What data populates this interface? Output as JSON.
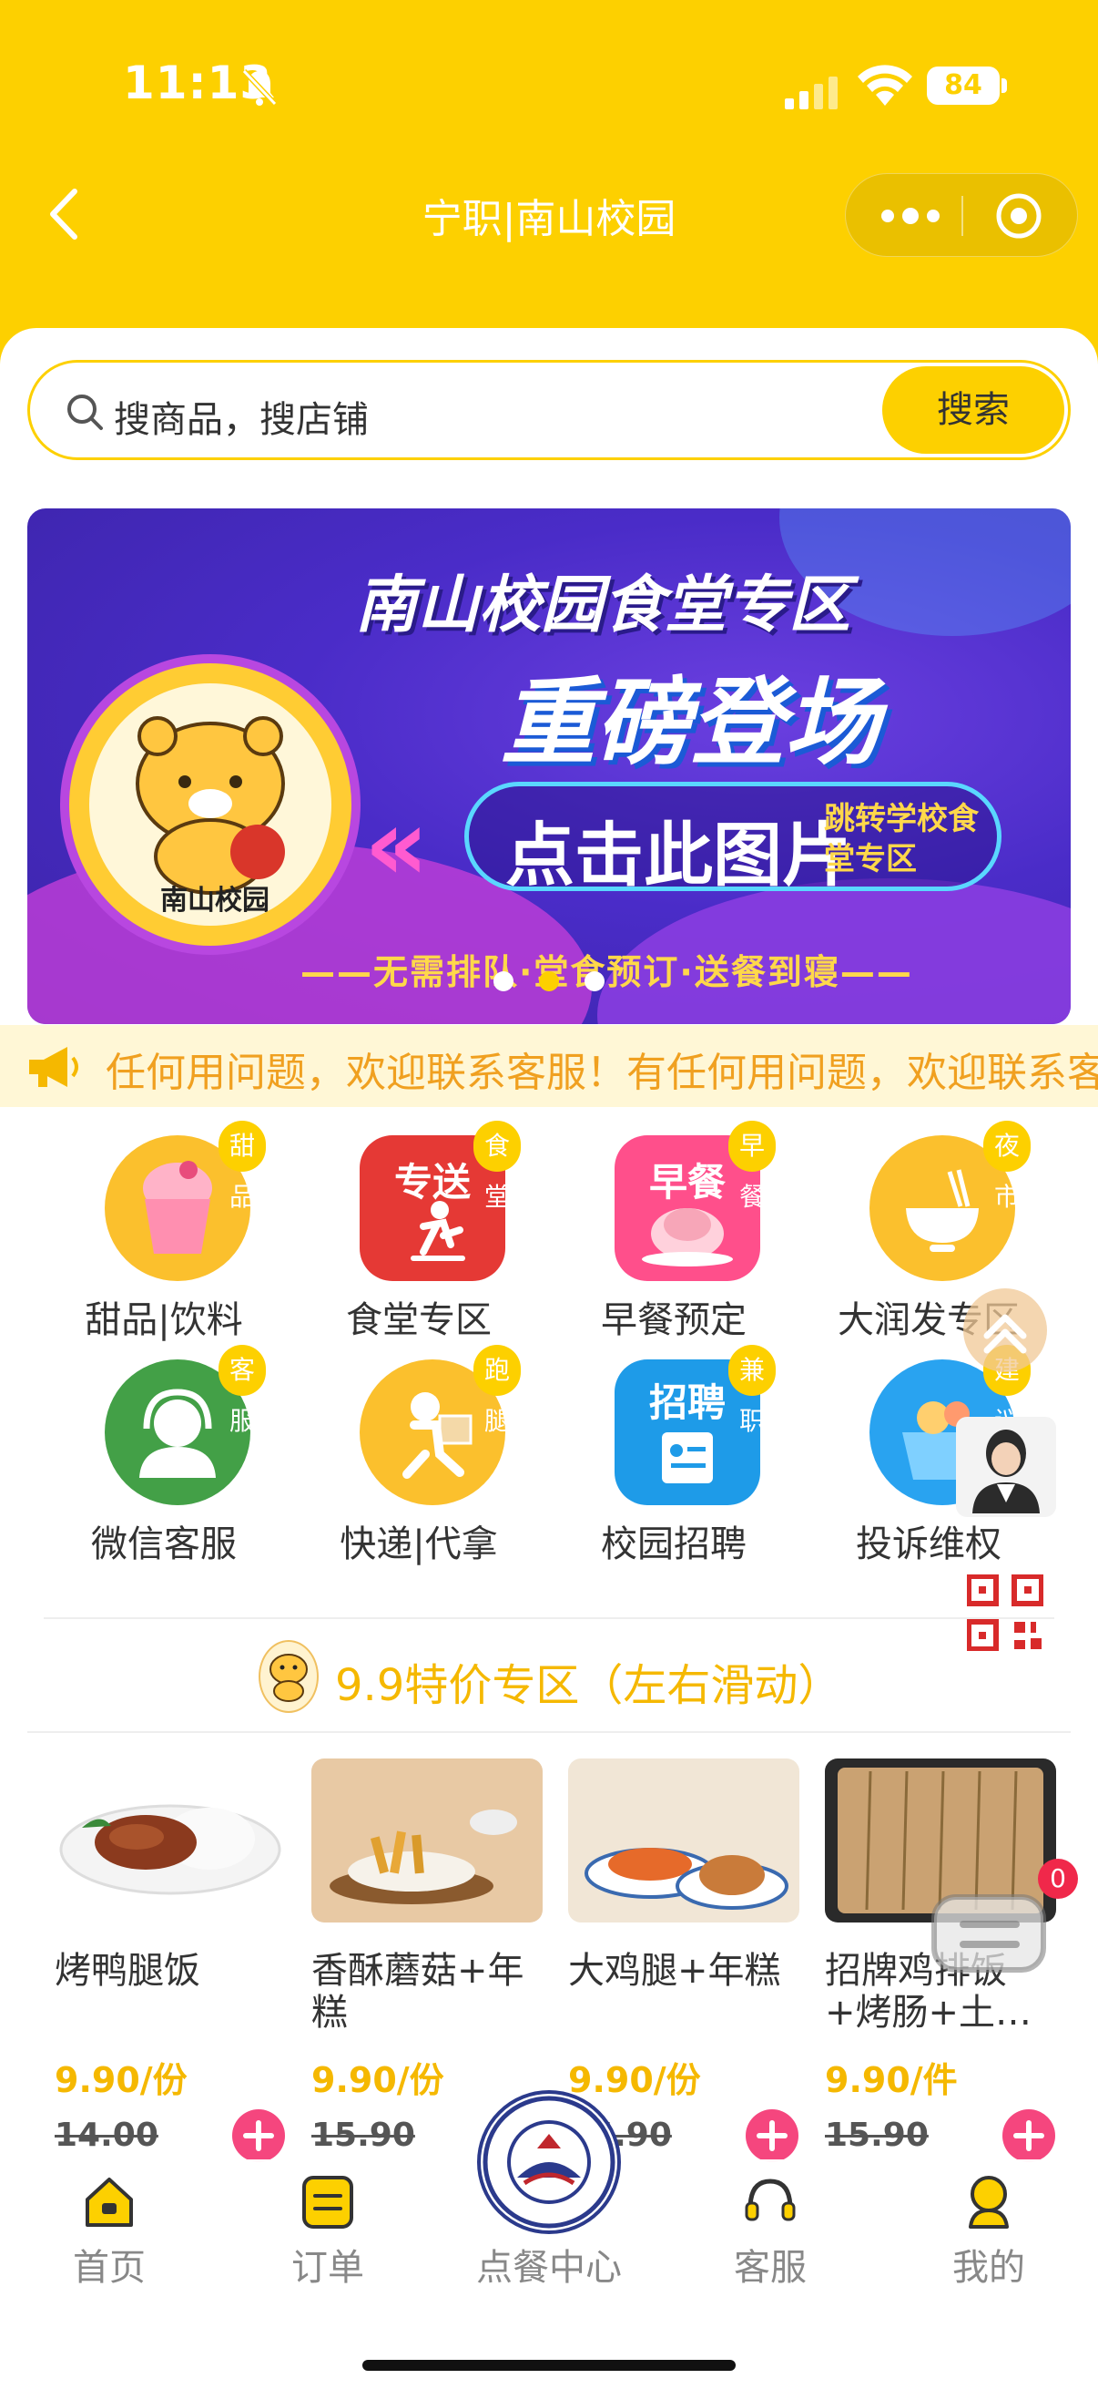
{
  "status_bar": {
    "time": "11:13",
    "battery": "84"
  },
  "nav": {
    "title": "宁职|南山校园"
  },
  "search": {
    "placeholder": "搜商品，搜店铺",
    "button": "搜索"
  },
  "banner": {
    "headline": "南山校园食堂专区",
    "subheadline": "重磅登场",
    "cta": "点击此图片",
    "cta_sub": "跳转学校食堂专区",
    "tagline": "——无需排队·堂食预订·送餐到寝——",
    "logo_text": "南山校园",
    "pagination": {
      "total": 3,
      "active": 1
    }
  },
  "notice": {
    "text": "任何用问题，欢迎联系客服！有任何用问题，欢迎联系客服！"
  },
  "categories": [
    {
      "label": "甜品|饮料",
      "badge": "甜品",
      "icon": "dessert-cup-icon",
      "color": "#fbc02d"
    },
    {
      "label": "食堂专区",
      "badge": "食堂",
      "icon": "delivery-runner-icon",
      "color": "#e53935",
      "glyph": "专送"
    },
    {
      "label": "早餐预定",
      "badge": "早餐",
      "icon": "breakfast-icon",
      "color": "#ff4f8b",
      "glyph": "早餐"
    },
    {
      "label": "大润发专区",
      "badge": "夜市",
      "icon": "noodle-bowl-icon",
      "color": "#fbc02d"
    },
    {
      "label": "微信客服",
      "badge": "客服",
      "icon": "customer-service-icon",
      "color": "#43a047"
    },
    {
      "label": "快递|代拿",
      "badge": "跑腿",
      "icon": "courier-icon",
      "color": "#fbc02d"
    },
    {
      "label": "校园招聘",
      "badge": "兼职",
      "icon": "recruit-icon",
      "color": "#1e9be8",
      "glyph": "招聘"
    },
    {
      "label": "投诉维权",
      "badge": "建议",
      "icon": "complaint-basket-icon",
      "color": "#29a3f0"
    }
  ],
  "special": {
    "title": "9.9特价专区（左右滑动）",
    "products": [
      {
        "name": "烤鸭腿饭",
        "price": "9.90/份",
        "original": "14.00"
      },
      {
        "name": "香酥蘑菇+年糕",
        "price": "9.90/份",
        "original": "15.90"
      },
      {
        "name": "大鸡腿+年糕",
        "price": "9.90/份",
        "original": "15.90"
      },
      {
        "name": "招牌鸡排饭+烤肠+土…",
        "price": "9.90/件",
        "original": "15.90"
      }
    ]
  },
  "cart": {
    "count": "0"
  },
  "tabbar": {
    "items": [
      {
        "label": "首页"
      },
      {
        "label": "订单"
      },
      {
        "label": "点餐中心"
      },
      {
        "label": "客服"
      },
      {
        "label": "我的"
      }
    ]
  },
  "colors": {
    "brand": "#fdd000",
    "price": "#f5b800",
    "accent_pink": "#f5467e",
    "notice_text": "#f0a020"
  }
}
